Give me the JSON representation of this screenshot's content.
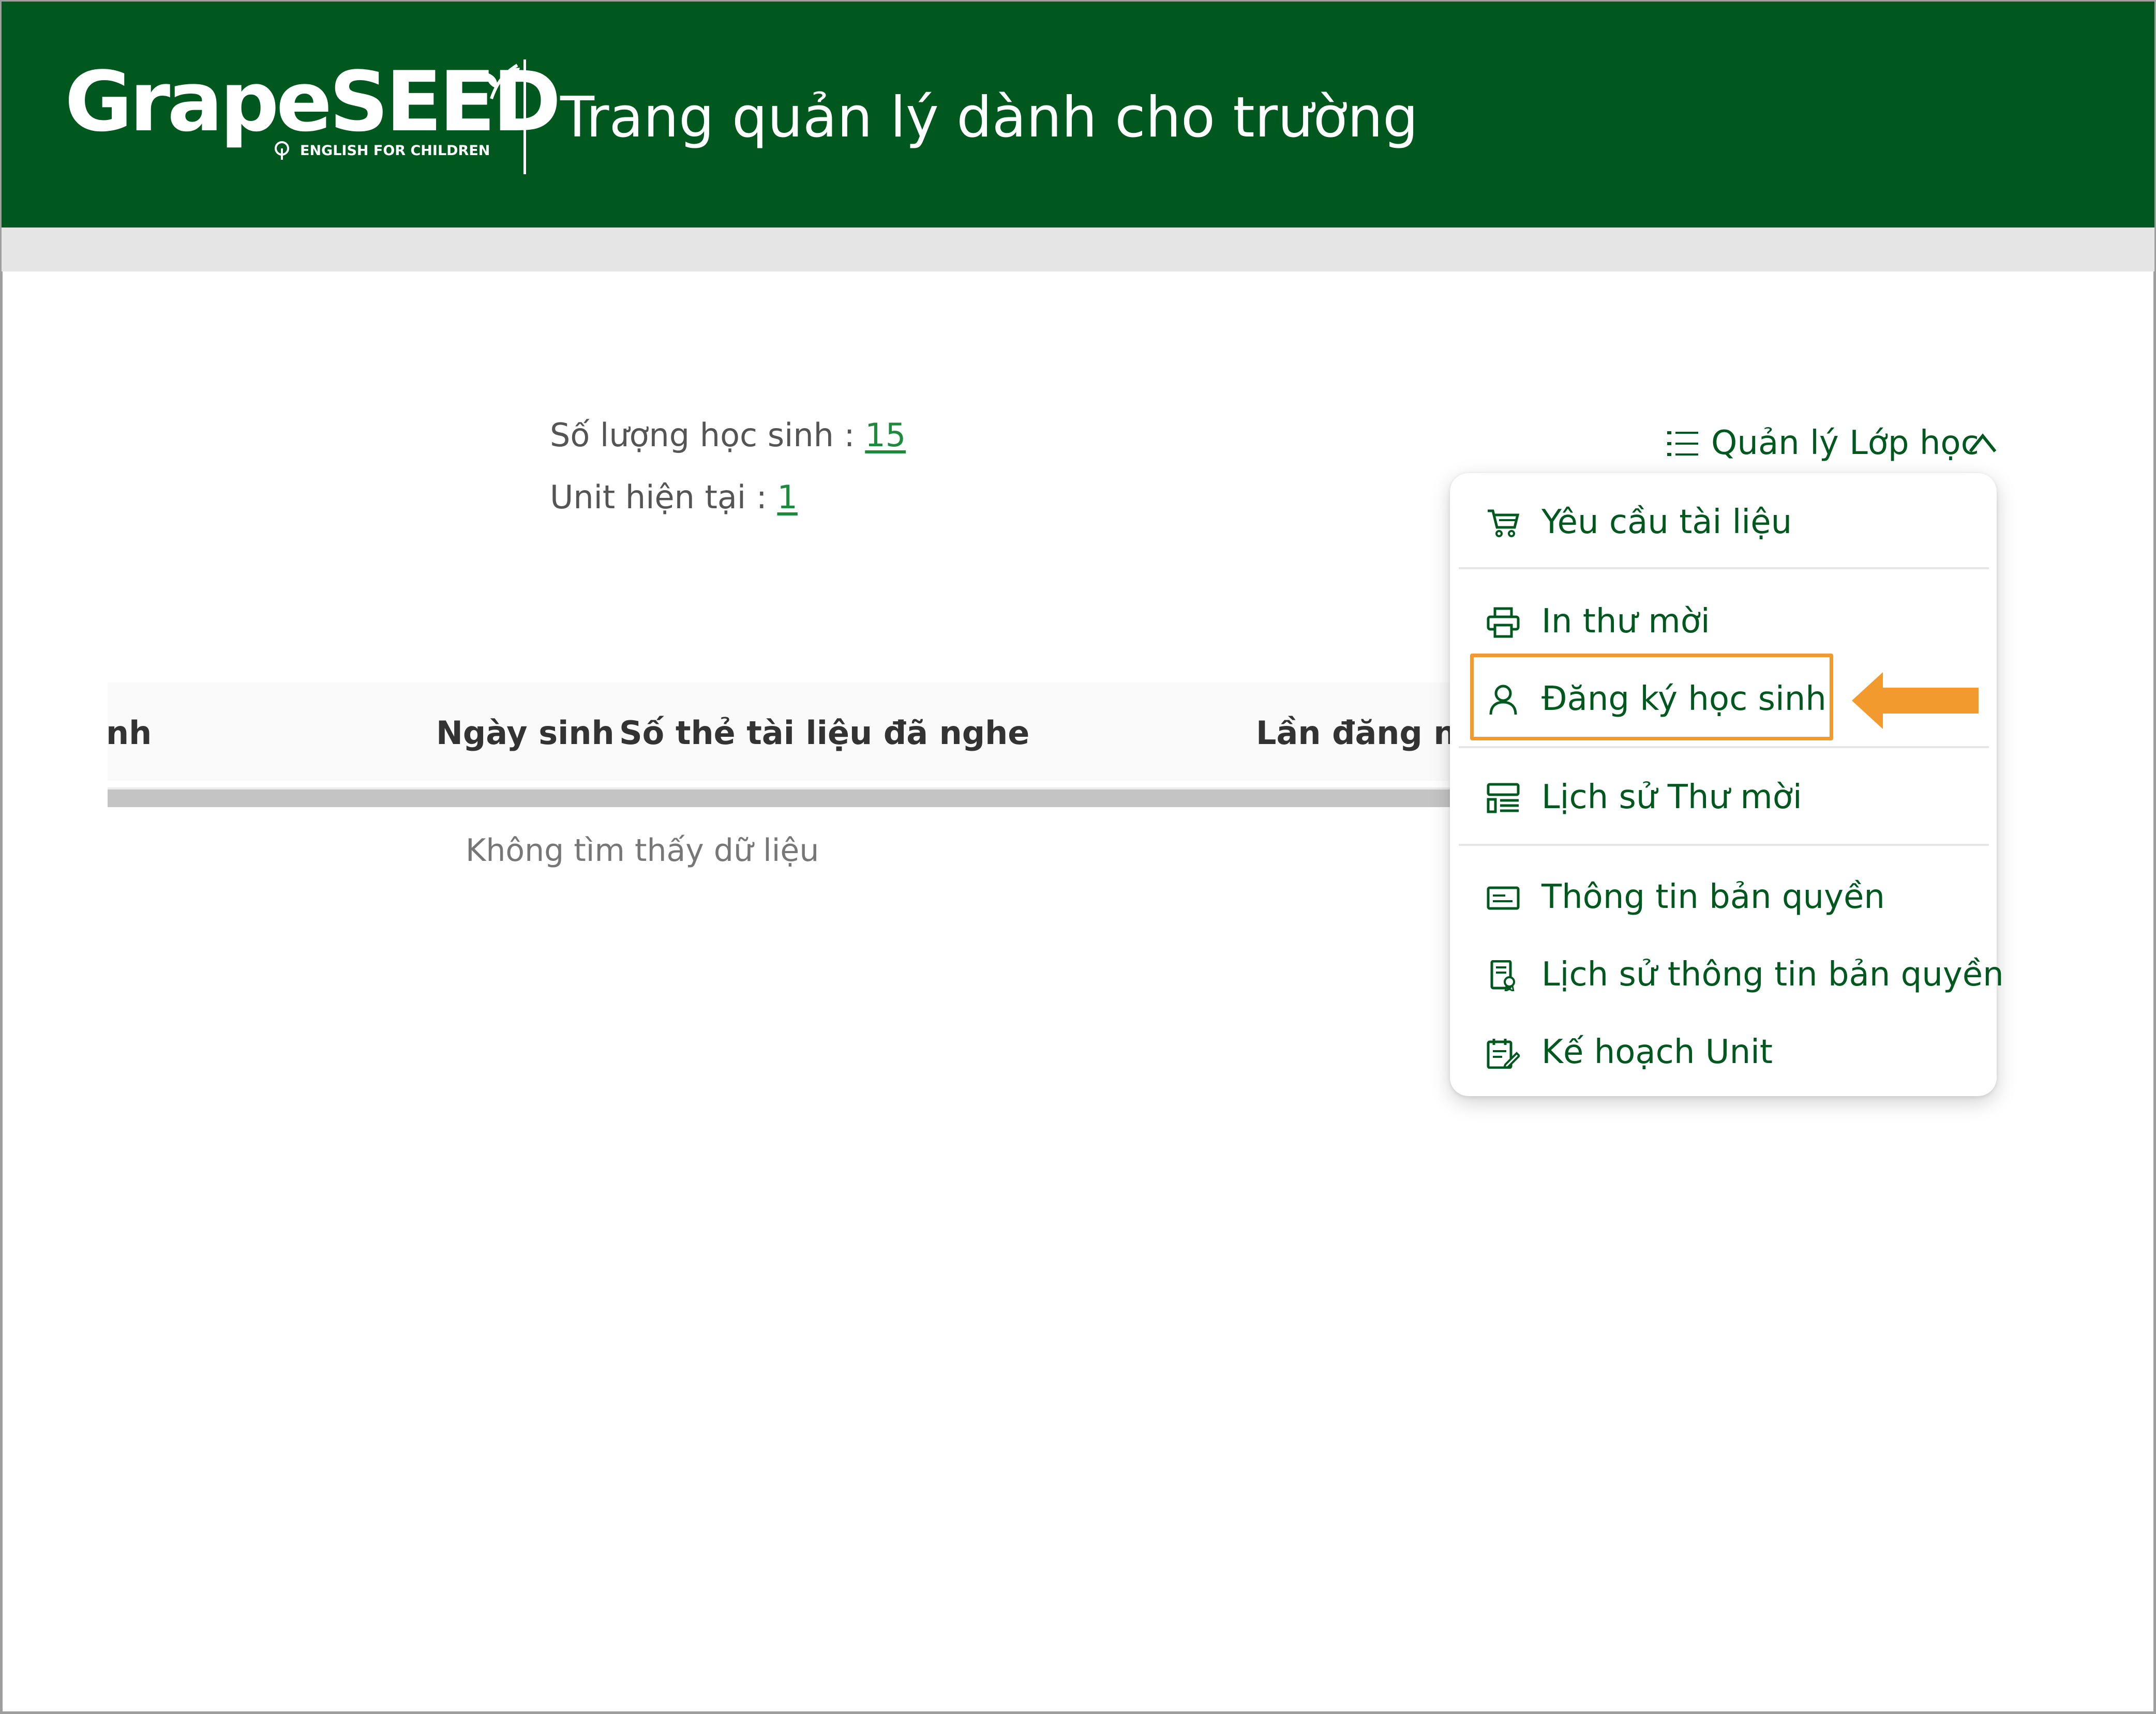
{
  "header": {
    "logo_text": "GrapeSEED",
    "logo_tagline": "ENGLISH FOR CHILDREN",
    "title": "Trang quản lý dành cho trường"
  },
  "info": {
    "student_count_label": "Số lượng học sinh :",
    "student_count_value": "15",
    "current_unit_label": "Unit hiện tại :",
    "current_unit_value": "1"
  },
  "table": {
    "columns": [
      "nh",
      "Ngày sinh",
      "Số thẻ tài liệu đã nghe",
      "Lần đăng nh"
    ],
    "empty_text": "Không tìm thấy dữ liệu"
  },
  "class_menu": {
    "toggle_label": "Quản lý Lớp học",
    "items": [
      {
        "label": "Yêu cầu tài liệu",
        "icon": "cart-icon"
      },
      {
        "label": "In thư mời",
        "icon": "printer-icon"
      },
      {
        "label": "Đăng ký học sinh",
        "icon": "user-icon",
        "highlighted": true
      },
      {
        "label": "Lịch sử Thư mời",
        "icon": "invitation-history-icon"
      },
      {
        "label": "Thông tin bản quyền",
        "icon": "license-card-icon"
      },
      {
        "label": "Lịch sử thông tin bản quyền",
        "icon": "license-history-icon"
      },
      {
        "label": "Kế hoạch Unit",
        "icon": "unit-plan-icon"
      }
    ]
  },
  "colors": {
    "brand_green": "#01581f",
    "link_green": "#1e8a3c",
    "highlight_orange": "#f29a2e"
  }
}
